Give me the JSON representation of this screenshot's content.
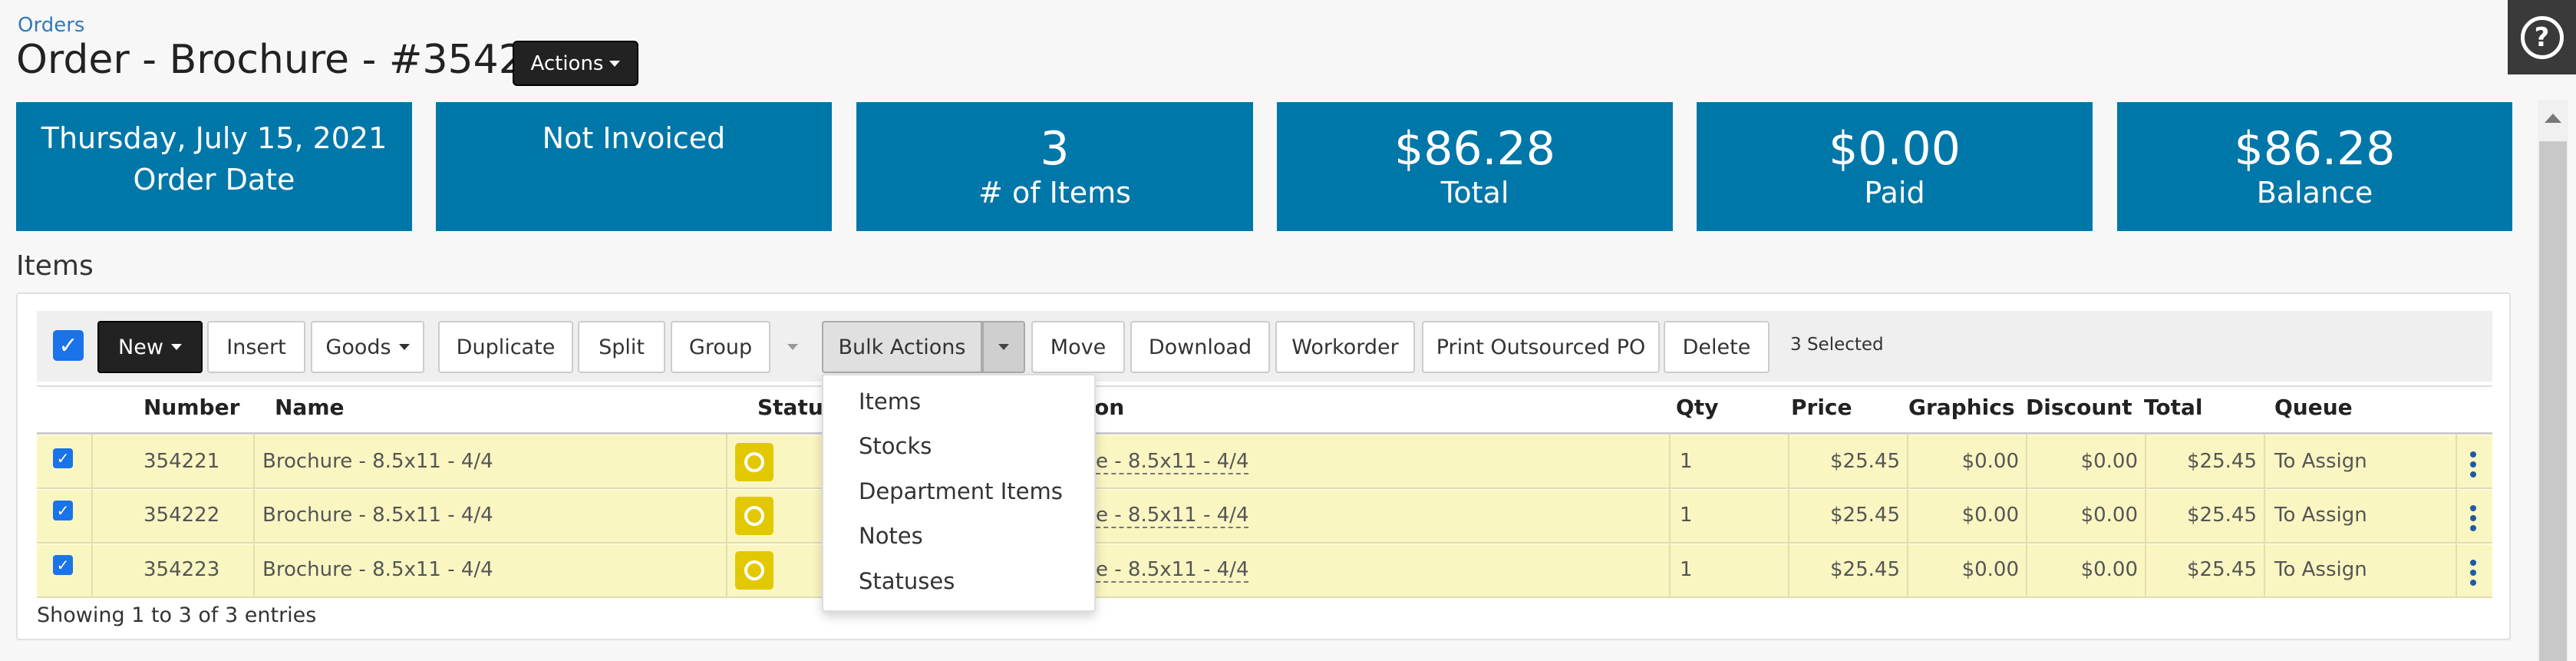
{
  "header": {
    "breadcrumb": "Orders",
    "title": "Order - Brochure - #35422",
    "actions_label": "Actions"
  },
  "cards": [
    {
      "line1": "Thursday, July 15, 2021",
      "line2": "Order Date"
    },
    {
      "line1": "Not Invoiced"
    },
    {
      "value": "3",
      "label": "# of Items"
    },
    {
      "value": "$86.28",
      "label": "Total"
    },
    {
      "value": "$0.00",
      "label": "Paid"
    },
    {
      "value": "$86.28",
      "label": "Balance"
    }
  ],
  "section_title": "Items",
  "toolbar": {
    "new": "New",
    "insert": "Insert",
    "goods": "Goods",
    "duplicate": "Duplicate",
    "split": "Split",
    "group": "Group",
    "bulk_actions": "Bulk Actions",
    "move": "Move",
    "download": "Download",
    "workorder": "Workorder",
    "print_po": "Print Outsourced PO",
    "delete": "Delete",
    "selected": "3 Selected"
  },
  "table": {
    "headers": {
      "number": "Number",
      "name": "Name",
      "status": "Status",
      "description_tail": "on",
      "qty": "Qty",
      "price": "Price",
      "graphics": "Graphics",
      "discount": "Discount",
      "total": "Total",
      "queue": "Queue"
    },
    "rows": [
      {
        "number": "354221",
        "name": "Brochure - 8.5x11 - 4/4",
        "desc": "e - 8.5x11 - 4/4",
        "qty": "1",
        "price": "$25.45",
        "graphics": "$0.00",
        "discount": "$0.00",
        "total": "$25.45",
        "queue": "To Assign"
      },
      {
        "number": "354222",
        "name": "Brochure - 8.5x11 - 4/4",
        "desc": "e - 8.5x11 - 4/4",
        "qty": "1",
        "price": "$25.45",
        "graphics": "$0.00",
        "discount": "$0.00",
        "total": "$25.45",
        "queue": "To Assign"
      },
      {
        "number": "354223",
        "name": "Brochure - 8.5x11 - 4/4",
        "desc": "e - 8.5x11 - 4/4",
        "qty": "1",
        "price": "$25.45",
        "graphics": "$0.00",
        "discount": "$0.00",
        "total": "$25.45",
        "queue": "To Assign"
      }
    ],
    "footer": "Showing 1 to 3 of 3 entries"
  },
  "bulk_menu": {
    "items": [
      "Items",
      "Stocks",
      "Department Items",
      "Notes",
      "Statuses"
    ]
  },
  "icons": {
    "help": "question-circle-icon",
    "status": "circle-status-icon",
    "row_menu": "kebab-vertical-icon",
    "check": "checkmark-icon"
  },
  "colors": {
    "card_bg": "#0077a9",
    "row_bg": "#faf6c2",
    "status_yellow": "#e2c800",
    "checkbox_blue": "#1a73e8"
  }
}
